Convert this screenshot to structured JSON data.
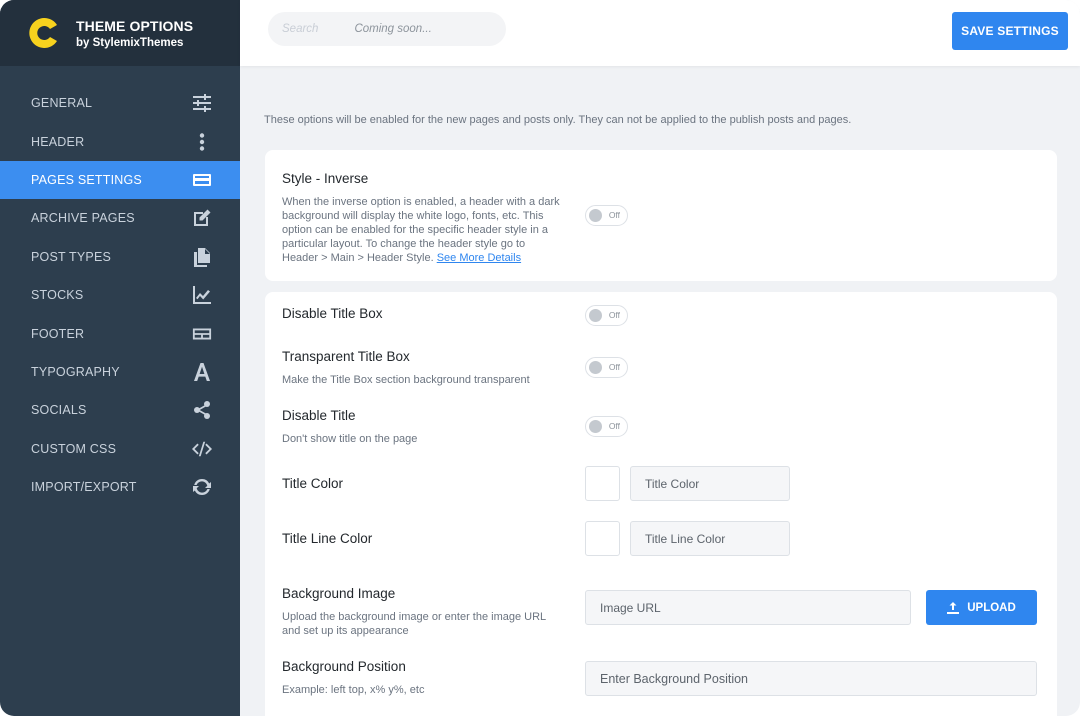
{
  "brand": {
    "logo_letter": "C",
    "title": "THEME OPTIONS",
    "subtitle": "by StylemixThemes",
    "logo_color": "#f7d21e"
  },
  "sidebar": {
    "items": [
      {
        "label": "GENERAL",
        "icon": "sliders-icon",
        "active": false
      },
      {
        "label": "HEADER",
        "icon": "dots-vertical-icon",
        "active": false
      },
      {
        "label": "PAGES SETTINGS",
        "icon": "card-icon",
        "active": true
      },
      {
        "label": "ARCHIVE PAGES",
        "icon": "edit-icon",
        "active": false
      },
      {
        "label": "POST TYPES",
        "icon": "files-icon",
        "active": false
      },
      {
        "label": "STOCKS",
        "icon": "chart-icon",
        "active": false
      },
      {
        "label": "FOOTER",
        "icon": "footer-icon",
        "active": false
      },
      {
        "label": "TYPOGRAPHY",
        "icon": "font-icon",
        "active": false
      },
      {
        "label": "SOCIALS",
        "icon": "share-icon",
        "active": false
      },
      {
        "label": "CUSTOM CSS",
        "icon": "code-icon",
        "active": false
      },
      {
        "label": "IMPORT/EXPORT",
        "icon": "sync-icon",
        "active": false
      }
    ]
  },
  "topbar": {
    "search_placeholder": "Search",
    "coming_soon": "Coming soon...",
    "save_label": "SAVE SETTINGS"
  },
  "content": {
    "note": "These options will be enabled for the new pages and posts only. They can not be applied to the publish posts and pages.",
    "style_inverse": {
      "label": "Style - Inverse",
      "desc": "When the inverse option is enabled, a header with a dark background will display the white logo, fonts, etc. This option can be enabled for the specific header style in a particular layout. To change the header style go to Header > Main > Header Style.",
      "link": "See More Details",
      "toggle": "Off"
    },
    "disable_title_box": {
      "label": "Disable Title Box",
      "toggle": "Off"
    },
    "transparent_title_box": {
      "label": "Transparent Title Box",
      "desc": "Make the Title Box section background transparent",
      "toggle": "Off"
    },
    "disable_title": {
      "label": "Disable Title",
      "desc": "Don't show title on the page",
      "toggle": "Off"
    },
    "title_color": {
      "label": "Title Color",
      "placeholder": "Title Color"
    },
    "title_line_color": {
      "label": "Title Line Color",
      "placeholder": "Title Line Color"
    },
    "background_image": {
      "label": "Background Image",
      "desc": "Upload the background image or enter the image URL and set up its appearance",
      "placeholder": "Image URL",
      "upload_label": "UPLOAD"
    },
    "background_position": {
      "label": "Background Position",
      "desc": "Example: left top, x% y%, etc",
      "placeholder": "Enter Background Position"
    }
  }
}
